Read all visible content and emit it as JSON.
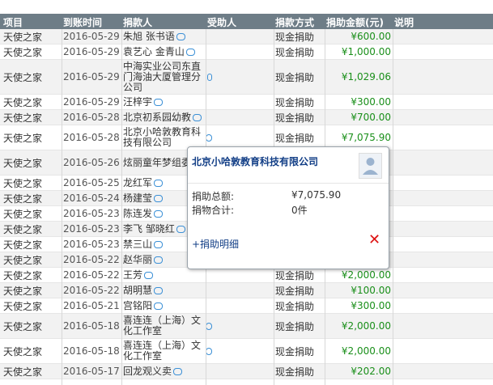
{
  "table": {
    "headers": [
      "项目",
      "到账时间",
      "捐款人",
      "受助人",
      "捐款方式",
      "捐助金额(元)",
      "说明"
    ],
    "rows": [
      {
        "project": "天使之家",
        "date": "2016-05-29",
        "donor": "朱旭 张书语",
        "method": "现金捐助",
        "amount": "¥600.00",
        "lines": 1
      },
      {
        "project": "天使之家",
        "date": "2016-05-29",
        "donor": "袁艺心 金青山",
        "method": "现金捐助",
        "amount": "¥1,000.00",
        "lines": 1
      },
      {
        "project": "天使之家",
        "date": "2016-05-29",
        "donor": "中海实业公司东直门海油大厦管理分公司",
        "method": "现金捐助",
        "amount": "¥1,029.06",
        "lines": 3
      },
      {
        "project": "天使之家",
        "date": "2016-05-29",
        "donor": "汪梓宇",
        "method": "现金捐助",
        "amount": "¥300.00",
        "lines": 1
      },
      {
        "project": "天使之家",
        "date": "2016-05-28",
        "donor": "北京初系园幼教",
        "method": "现金捐助",
        "amount": "¥700.00",
        "lines": 1
      },
      {
        "project": "天使之家",
        "date": "2016-05-28",
        "donor": "北京小哈敦教育科技有限公司",
        "method": "现金捐助",
        "amount": "¥7,075.90",
        "lines": 2
      },
      {
        "project": "天使之家",
        "date": "2016-05-26",
        "donor": "炫丽童年梦组委",
        "method": "",
        "amount": "",
        "lines": 2
      },
      {
        "project": "天使之家",
        "date": "2016-05-25",
        "donor": "龙红军",
        "method": "",
        "amount": "",
        "lines": 1
      },
      {
        "project": "天使之家",
        "date": "2016-05-24",
        "donor": "杨建莹",
        "method": "",
        "amount": "",
        "lines": 1
      },
      {
        "project": "天使之家",
        "date": "2016-05-23",
        "donor": "陈连发",
        "method": "",
        "amount": "",
        "lines": 1
      },
      {
        "project": "天使之家",
        "date": "2016-05-23",
        "donor": "李飞 邹晓红",
        "method": "",
        "amount": "",
        "lines": 1
      },
      {
        "project": "天使之家",
        "date": "2016-05-23",
        "donor": "禁三山",
        "method": "",
        "amount": "",
        "lines": 1
      },
      {
        "project": "天使之家",
        "date": "2016-05-22",
        "donor": "赵华丽",
        "method": "",
        "amount": "",
        "lines": 1
      },
      {
        "project": "天使之家",
        "date": "2016-05-22",
        "donor": "王芳",
        "method": "现金捐助",
        "amount": "¥2,000.00",
        "lines": 1
      },
      {
        "project": "天使之家",
        "date": "2016-05-22",
        "donor": "胡明慧",
        "method": "现金捐助",
        "amount": "¥100.00",
        "lines": 1
      },
      {
        "project": "天使之家",
        "date": "2016-05-21",
        "donor": "宫铭阳",
        "method": "现金捐助",
        "amount": "¥300.00",
        "lines": 1
      },
      {
        "project": "天使之家",
        "date": "2016-05-18",
        "donor": "喜连连（上海）文化工作室",
        "method": "现金捐助",
        "amount": "¥2,000.00",
        "lines": 2
      },
      {
        "project": "天使之家",
        "date": "2016-05-18",
        "donor": "喜连连（上海）文化工作室",
        "method": "现金捐助",
        "amount": "¥2,000.00",
        "lines": 2
      },
      {
        "project": "天使之家",
        "date": "2016-05-17",
        "donor": "回龙观义卖",
        "method": "现金捐助",
        "amount": "¥202.00",
        "lines": 1
      }
    ]
  },
  "popup": {
    "title": "北京小哈敦教育科技有限公司",
    "total_label": "捐助总额:",
    "total_value": "¥7,075.90",
    "items_label": "捐物合计:",
    "items_value": "0件",
    "detail_link": "+捐助明细",
    "close_glyph": "✕",
    "avatar_icon": "person-placeholder-icon"
  },
  "colors": {
    "header_bg": "#6e7d87",
    "amount_green": "#1a8f1a",
    "popup_title_blue": "#123e86",
    "close_red": "#d11111"
  }
}
